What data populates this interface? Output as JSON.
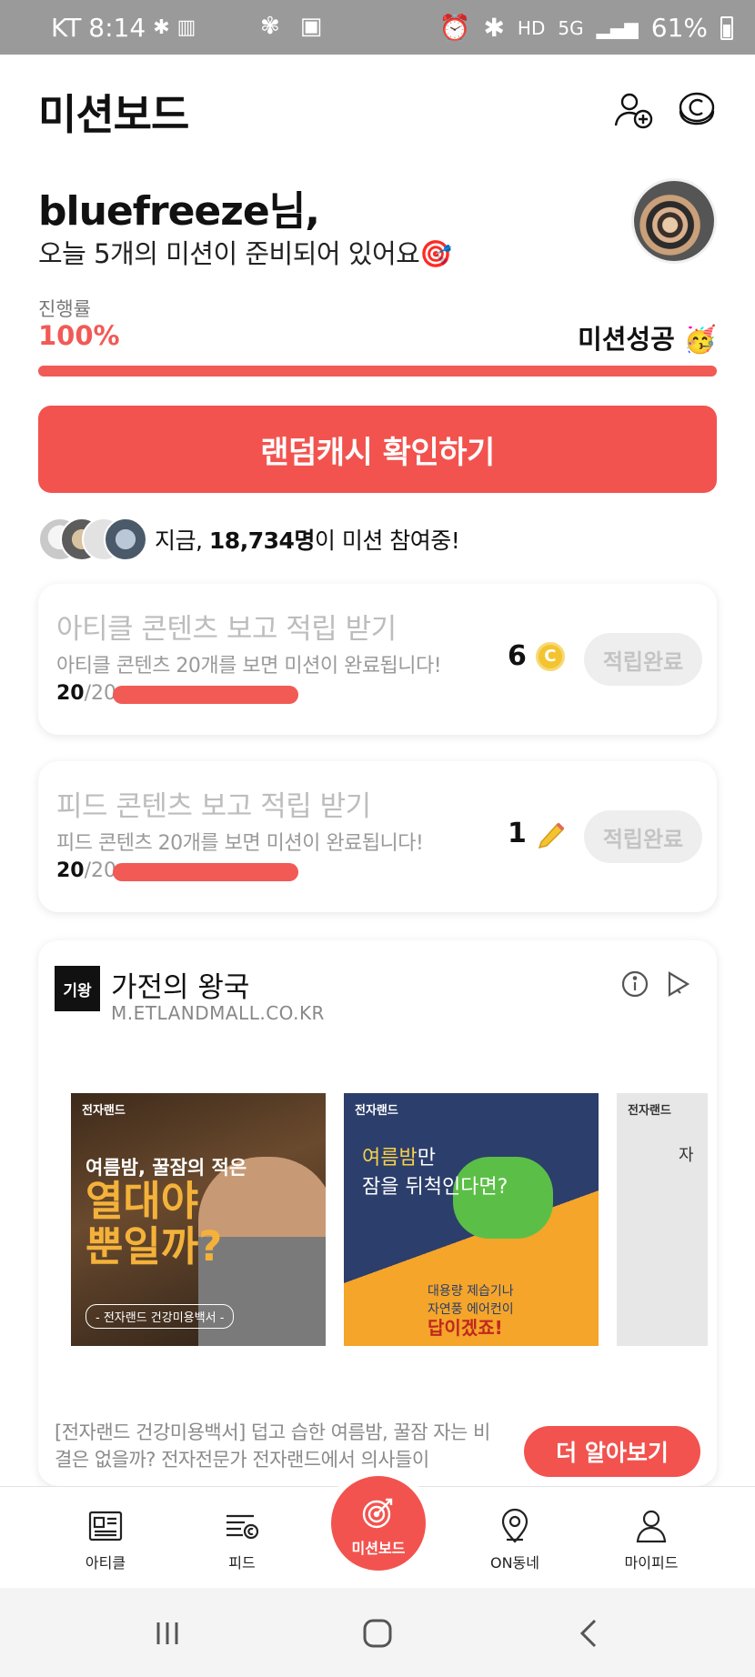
{
  "status_bar": {
    "carrier": "KT",
    "time": "8:14",
    "network_badges": [
      "HD",
      "5G"
    ],
    "battery": "61%"
  },
  "header": {
    "title": "미션보드",
    "icons": [
      "add-user-icon",
      "cash-icon"
    ]
  },
  "greeting": {
    "name": "bluefreeze님,",
    "subtitle": "오늘 5개의 미션이 준비되어 있어요🎯"
  },
  "progress": {
    "label": "진행률",
    "value_text": "100%",
    "value": 1.0,
    "success_text": "미션성공 🥳"
  },
  "cta": {
    "label": "랜덤캐시 확인하기"
  },
  "participants": {
    "prefix": "지금, ",
    "count": "18,734명",
    "suffix": "이 미션 참여중!"
  },
  "missions": [
    {
      "title": "아티클 콘텐츠 보고 적립 받기",
      "desc": "아티클 콘텐츠 20개를 보면 미션이 완료됩니다!",
      "done": "20",
      "total": "/20",
      "progress": 1.0,
      "reward": "6",
      "reward_icon": "coin-icon",
      "button": "적립완료"
    },
    {
      "title": "피드 콘텐츠 보고 적립 받기",
      "desc": "피드 콘텐츠 20개를 보면 미션이 완료됩니다!",
      "done": "20",
      "total": "/20",
      "progress": 1.0,
      "reward": "1",
      "reward_icon": "pencil-icon",
      "button": "적립완료"
    }
  ],
  "ad": {
    "logo_text": "기왕",
    "name": "가전의 왕국",
    "url": "M.ETLANDMALL.CO.KR",
    "images": [
      {
        "brand": "전자랜드",
        "headline": "여름밤, 꿀잠의 적은",
        "big": "열대야\n뿐일까?",
        "footer": "- 전자랜드 건강미용백서 -"
      },
      {
        "brand": "전자랜드",
        "headline_1": "여름밤",
        "headline_2": "만",
        "headline_3": "잠을 뒤척인다면?",
        "footer_1": "대용량 제습기나",
        "footer_2": "자연풍 에어컨이",
        "footer_3": "답이겠죠!"
      },
      {
        "brand": "전자랜드",
        "text": "자"
      }
    ],
    "description": "[전자랜드 건강미용백서] 덥고 습한 여름밤, 꿀잠 자는 비결은 없을까?  전자전문가 전자랜드에서 의사들이",
    "button": "더 알아보기"
  },
  "bottom_nav": {
    "items": [
      {
        "label": "아티클",
        "icon": "article-icon"
      },
      {
        "label": "피드",
        "icon": "feed-icon"
      },
      {
        "label": "미션보드",
        "icon": "target-icon",
        "active": true
      },
      {
        "label": "ON동네",
        "icon": "location-pin-icon"
      },
      {
        "label": "마이피드",
        "icon": "person-icon"
      }
    ]
  },
  "colors": {
    "accent": "#f2534f",
    "muted_text": "#bdbdbd",
    "coin": "#f4c430"
  }
}
